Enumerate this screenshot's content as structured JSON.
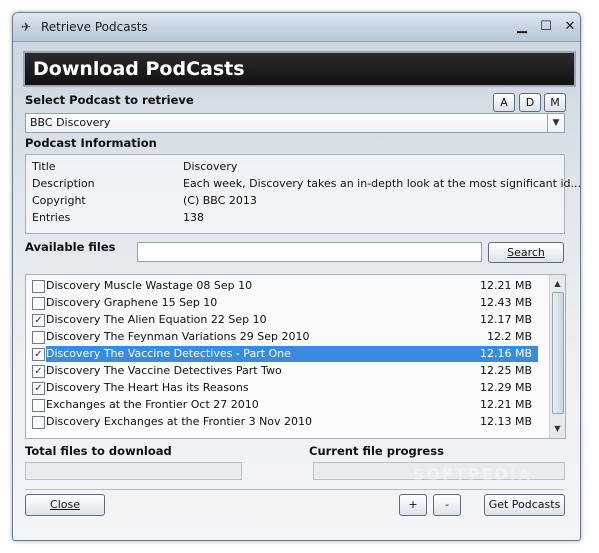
{
  "window": {
    "title": "Retrieve Podcasts",
    "watermark": "SOFTPEDIA"
  },
  "header": {
    "title": "Download PodCasts"
  },
  "select_section": {
    "label": "Select Podcast to retrieve",
    "buttons": [
      "A",
      "D",
      "M"
    ],
    "dropdown_value": "BBC Discovery"
  },
  "info_section": {
    "label": "Podcast Information",
    "rows": [
      {
        "key": "Title",
        "value": "Discovery"
      },
      {
        "key": "Description",
        "value": "Each week, Discovery takes an in-depth look at the most significant id..."
      },
      {
        "key": "Copyright",
        "value": "(C) BBC 2013"
      },
      {
        "key": "Entries",
        "value": "138"
      }
    ]
  },
  "files_section": {
    "label": "Available files",
    "search_value": "",
    "search_button": "Search",
    "files": [
      {
        "name": "Discovery Muscle Wastage 08 Sep 10",
        "size": "12.21 MB",
        "checked": false,
        "selected": false
      },
      {
        "name": "Discovery Graphene 15 Sep 10",
        "size": "12.43 MB",
        "checked": false,
        "selected": false
      },
      {
        "name": "Discovery The Alien Equation 22 Sep 10",
        "size": "12.17 MB",
        "checked": true,
        "selected": false
      },
      {
        "name": "Discovery The Feynman Variations 29 Sep 2010",
        "size": "12.2 MB",
        "checked": false,
        "selected": false
      },
      {
        "name": "Discovery The Vaccine Detectives - Part One",
        "size": "12.16 MB",
        "checked": true,
        "selected": true
      },
      {
        "name": "Discovery The Vaccine Detectives Part Two",
        "size": "12.25 MB",
        "checked": true,
        "selected": false
      },
      {
        "name": "Discovery The Heart Has its Reasons",
        "size": "12.29 MB",
        "checked": true,
        "selected": false
      },
      {
        "name": "Exchanges at the Frontier Oct 27 2010",
        "size": "12.21 MB",
        "checked": false,
        "selected": false
      },
      {
        "name": "Discovery Exchanges at the Frontier 3 Nov 2010",
        "size": "12.13 MB",
        "checked": false,
        "selected": false
      }
    ]
  },
  "progress_section": {
    "total_label": "Total files to download",
    "current_label": "Current file progress"
  },
  "footer": {
    "close_label": "Close",
    "plus_label": "+",
    "minus_label": "-",
    "get_label": "Get Podcasts"
  }
}
